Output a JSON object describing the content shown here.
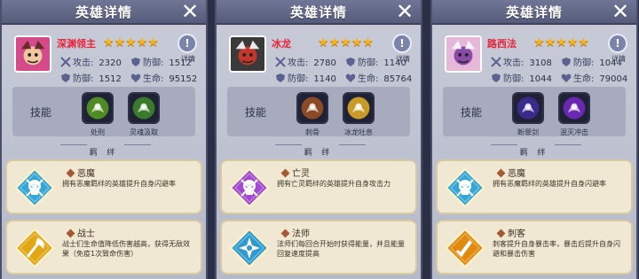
{
  "panels": [
    {
      "title": "英雄详情",
      "close_icon": "close-icon",
      "hero_name": "深渊领主",
      "star_count": 5,
      "info_label": "详情",
      "stats": [
        {
          "label": "攻击:",
          "value": "2320",
          "icon": "sword-icon"
        },
        {
          "label": "防御:",
          "value": "1512",
          "icon": "shield-icon"
        },
        {
          "label": "防御:",
          "value": "1512",
          "icon": "shield-icon"
        },
        {
          "label": "生命:",
          "value": "95152",
          "icon": "heart-icon"
        }
      ],
      "skills_label": "技能",
      "skills": [
        {
          "name": "处刑",
          "color": "#4f8a24"
        },
        {
          "name": "灵魂汲取",
          "color": "#3a7a2a"
        }
      ],
      "bond_label": "羁 绊",
      "bonds": [
        {
          "name": "恶魔",
          "desc": "拥有恶魔羁绊的英雄提升自身闪避率",
          "color": "#35a6d6",
          "emblem": "skull-emblem-icon"
        },
        {
          "name": "战士",
          "desc": "战士们生命值降低伤害越高，获得无敌效果（免疫1次致命伤害）",
          "color": "#e2a514",
          "emblem": "axe-emblem-icon"
        }
      ]
    },
    {
      "title": "英雄详情",
      "close_icon": "close-icon",
      "hero_name": "冰龙",
      "star_count": 5,
      "info_label": "详情",
      "stats": [
        {
          "label": "攻击:",
          "value": "2780",
          "icon": "sword-icon"
        },
        {
          "label": "防御:",
          "value": "1140",
          "icon": "shield-icon"
        },
        {
          "label": "防御:",
          "value": "1140",
          "icon": "shield-icon"
        },
        {
          "label": "生命:",
          "value": "85764",
          "icon": "heart-icon"
        }
      ],
      "skills_label": "技能",
      "skills": [
        {
          "name": "刺骨",
          "color": "#8a4a26"
        },
        {
          "name": "冰龙吐息",
          "color": "#c89a2a"
        }
      ],
      "bond_label": "羁 绊",
      "bonds": [
        {
          "name": "亡灵",
          "desc": "拥有亡灵羁绊的英雄提升自身攻击力",
          "color": "#a24ad0",
          "emblem": "skull-emblem-icon"
        },
        {
          "name": "法师",
          "desc": "法师们每回合开始时获得能量，并且能量回复速度提高",
          "color": "#2e9ad0",
          "emblem": "star-emblem-icon"
        }
      ]
    },
    {
      "title": "英雄详情",
      "close_icon": "close-icon",
      "hero_name": "路西法",
      "star_count": 5,
      "info_label": "详情",
      "stats": [
        {
          "label": "攻击:",
          "value": "3108",
          "icon": "sword-icon"
        },
        {
          "label": "防御:",
          "value": "1044",
          "icon": "shield-icon"
        },
        {
          "label": "防御:",
          "value": "1044",
          "icon": "shield-icon"
        },
        {
          "label": "生命:",
          "value": "79004",
          "icon": "heart-icon"
        }
      ],
      "skills_label": "技能",
      "skills": [
        {
          "name": "断罪剑",
          "color": "#3a2b8a"
        },
        {
          "name": "泯灭冲击",
          "color": "#6a28b0"
        }
      ],
      "bond_label": "羁 绊",
      "bonds": [
        {
          "name": "恶魔",
          "desc": "拥有恶魔羁绊的英雄提升自身闪避率",
          "color": "#35a6d6",
          "emblem": "skull-emblem-icon"
        },
        {
          "name": "刺客",
          "desc": "刺客提升自身暴击率，暴击后提升自身闪避和暴击伤害",
          "color": "#e08a10",
          "emblem": "dagger-emblem-icon"
        }
      ]
    }
  ],
  "colors": {
    "star": "#f6b21b",
    "hero_name": "#e8243a",
    "titlebar": "#5f6585",
    "panel_bg": "#c3c7d4"
  }
}
